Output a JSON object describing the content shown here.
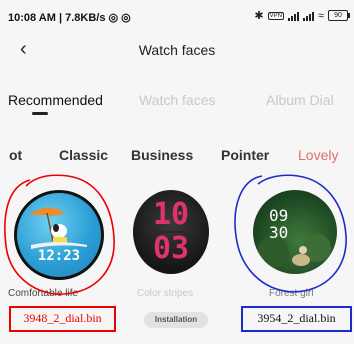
{
  "status_bar": {
    "time": "10:08 AM | 7.8KB/s",
    "left_icons": [
      "sync-icon",
      "notification-icon"
    ],
    "right_icons": [
      "bluetooth-icon",
      "vpn-icon",
      "signal-icon",
      "signal-icon",
      "wifi-icon",
      "battery-icon"
    ],
    "vpn": "VPN",
    "battery": "90"
  },
  "header": {
    "back_icon": "‹",
    "title": "Watch faces"
  },
  "tabs": [
    {
      "label": "Recommended",
      "active": true
    },
    {
      "label": "Watch faces",
      "active": false
    },
    {
      "label": "Album Dial",
      "active": false
    }
  ],
  "categories": [
    {
      "label": "ot"
    },
    {
      "label": "Classic"
    },
    {
      "label": "Business"
    },
    {
      "label": "Pointer"
    },
    {
      "label": "Lovely",
      "color": "#e26a6a"
    }
  ],
  "faces": [
    {
      "name": "Comfortable life",
      "time": "12:23",
      "tag": "3948_2_dial.bin",
      "tag_color": "#e00000"
    },
    {
      "name": "Color stripes",
      "time_h": "10",
      "time_m": "03",
      "button": "Installation"
    },
    {
      "name": "Forest girl",
      "time_h": "09",
      "time_m": "30",
      "tag": "3954_2_dial.bin",
      "tag_color": "#1c2ccc"
    }
  ]
}
